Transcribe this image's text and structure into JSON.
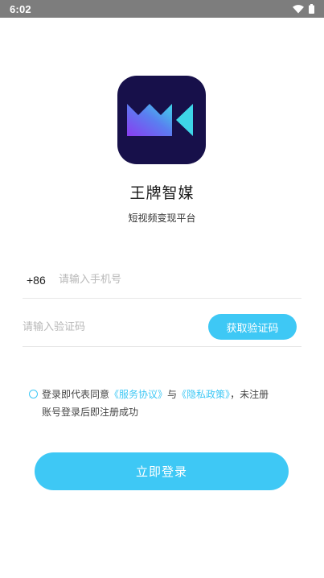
{
  "status_bar": {
    "time": "6:02",
    "icons": [
      "wifi-icon",
      "battery-icon"
    ]
  },
  "app": {
    "name": "王牌智媒",
    "subtitle": "短视频变现平台",
    "logo_colors": {
      "background": "#17104a",
      "gradient_start": "#8a3cf0",
      "gradient_end": "#3ed6e8"
    }
  },
  "form": {
    "country_code": "+86",
    "phone_placeholder": "请输入手机号",
    "phone_value": "",
    "code_placeholder": "请输入验证码",
    "code_value": "",
    "get_code_label": "获取验证码"
  },
  "agreement": {
    "checked": false,
    "prefix": "登录即代表同意",
    "terms_link": "《服务协议》",
    "conjunction": "与",
    "privacy_link": "《隐私政策》",
    "suffix_line1": "，未注册",
    "suffix_line2": "账号登录后即注册成功"
  },
  "login_button_label": "立即登录",
  "colors": {
    "accent": "#3ec8f5",
    "status_bar": "#7d7d7d"
  }
}
